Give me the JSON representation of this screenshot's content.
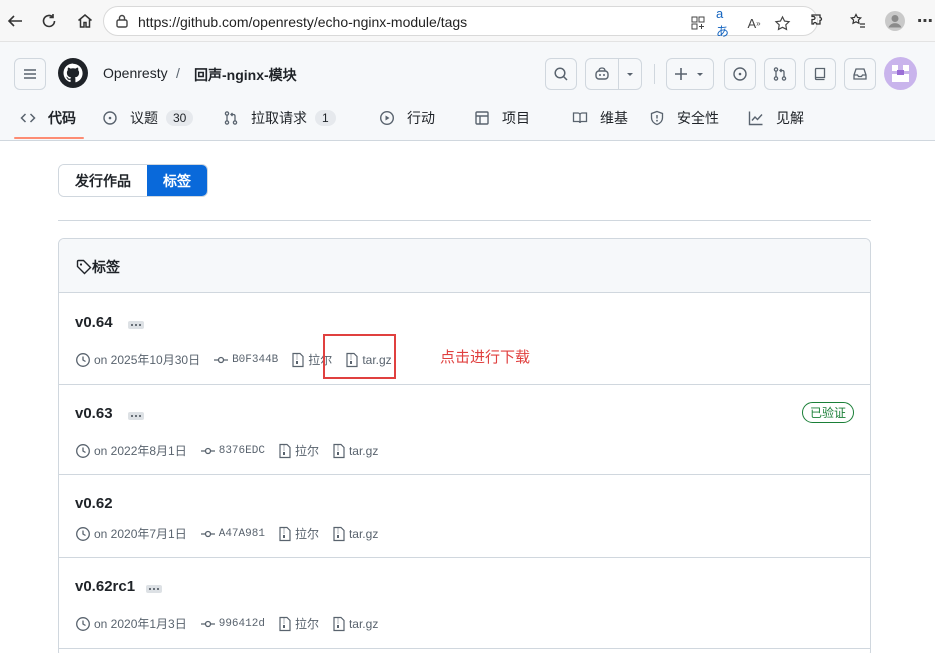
{
  "browser": {
    "url": "https://github.com/openresty/echo-nginx-module/tags"
  },
  "repo": {
    "owner": "Openresty",
    "slash": "/",
    "name": "回声-nginx-模块"
  },
  "tabs": [
    {
      "label": "代码",
      "icon": "code-icon"
    },
    {
      "label": "议题",
      "icon": "issue-icon",
      "count": "30"
    },
    {
      "label": "拉取请求",
      "icon": "pull-request-icon",
      "count": "1"
    },
    {
      "label": "行动",
      "icon": "play-icon"
    },
    {
      "label": "项目",
      "icon": "table-icon"
    },
    {
      "label": "维基",
      "icon": "book-icon"
    },
    {
      "label": "安全性",
      "icon": "shield-icon"
    },
    {
      "label": "见解",
      "icon": "graph-icon"
    }
  ],
  "segmented": {
    "releases": "发行作品",
    "tags": "标签"
  },
  "box_title": "标签",
  "tags": [
    {
      "name": "v0.64",
      "date": "on 2025年10月30日",
      "commit": "B0F344B",
      "zip": "拉尔",
      "tar": "tar.gz",
      "verified": ""
    },
    {
      "name": "v0.63",
      "date": "on 2022年8月1日",
      "commit": "8376EDC",
      "zip": "拉尔",
      "tar": "tar.gz",
      "verified": "已验证"
    },
    {
      "name": "v0.62",
      "date": "on 2020年7月1日",
      "commit": "A47A981",
      "zip": "拉尔",
      "tar": "tar.gz",
      "verified": ""
    },
    {
      "name": "v0.62rc1",
      "date": "on 2020年1月3日",
      "commit": "996412d",
      "zip": "拉尔",
      "tar": "tar.gz",
      "verified": ""
    }
  ],
  "annotation": "点击进行下载",
  "colors": {
    "accent": "#0969da",
    "annotation": "#e0403f",
    "verified": "#1a7f37",
    "tab_underline": "#fd8c73"
  }
}
